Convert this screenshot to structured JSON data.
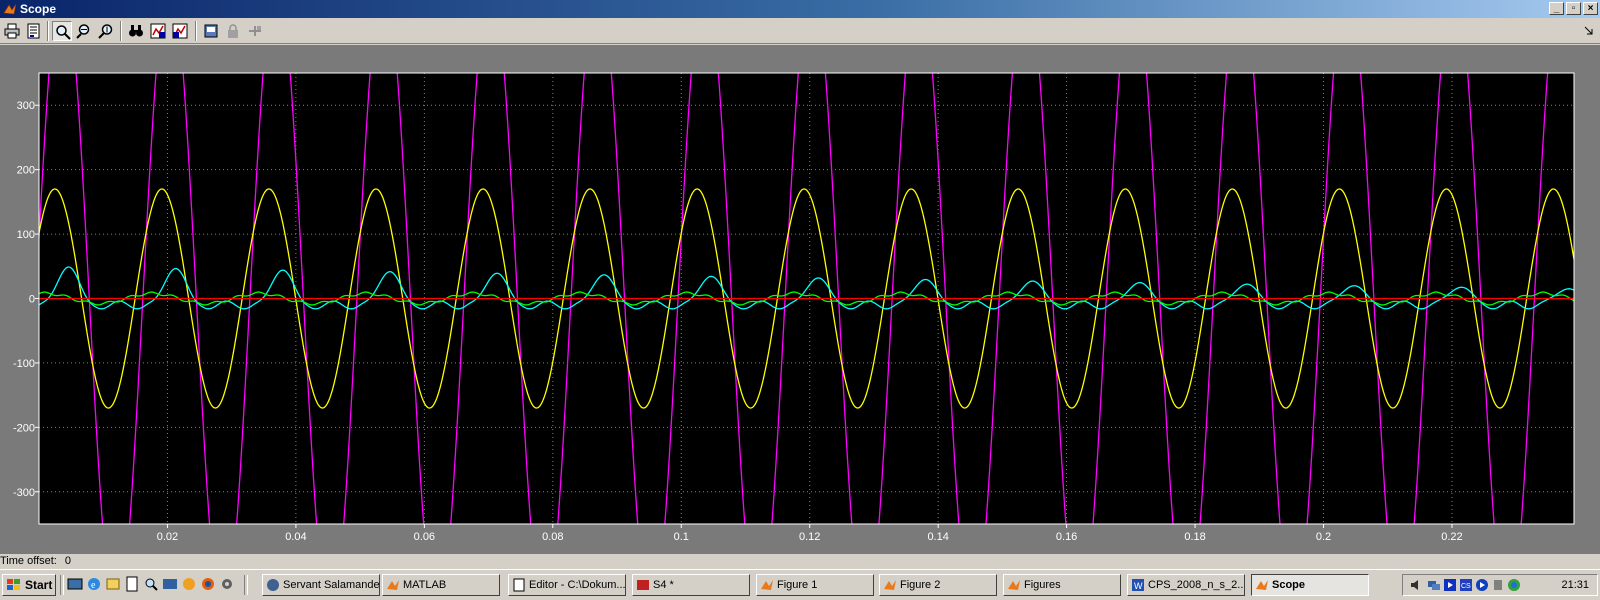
{
  "window": {
    "title": "Scope"
  },
  "toolbar": {
    "buttons": [
      {
        "name": "print-icon"
      },
      {
        "name": "parameters-icon"
      },
      {
        "name": "zoom-icon"
      },
      {
        "name": "zoom-x-icon"
      },
      {
        "name": "zoom-y-icon"
      },
      {
        "name": "autoscale-icon"
      },
      {
        "name": "save-axes-settings-icon"
      },
      {
        "name": "restore-axes-settings-icon"
      },
      {
        "name": "floating-scope-icon"
      },
      {
        "name": "lock-axes-icon"
      },
      {
        "name": "signal-selection-icon"
      }
    ]
  },
  "chart_data": {
    "type": "line",
    "title": "",
    "xlabel": "",
    "ylabel": "",
    "xlim": [
      0.0,
      0.239
    ],
    "ylim": [
      -350,
      350
    ],
    "grid": true,
    "background": "#000000",
    "xticks": [
      0.02,
      0.04,
      0.06,
      0.08,
      0.1,
      0.12,
      0.14,
      0.16,
      0.18,
      0.2,
      0.22
    ],
    "xtick_labels": [
      "0.02",
      "0.04",
      "0.06",
      "0.08",
      "0.1",
      "0.12",
      "0.14",
      "0.16",
      "0.18",
      "0.2",
      "0.22"
    ],
    "yticks": [
      -300,
      -200,
      -100,
      0,
      100,
      200,
      300
    ],
    "ytick_labels": [
      "-300",
      "-200",
      "-100",
      "0",
      "100",
      "200",
      "300"
    ],
    "series": [
      {
        "color": "#ff00ff",
        "description_values": {
          "amplitude": 500,
          "frequency_hz": 60,
          "phase_offset_s": 0.0005
        }
      },
      {
        "color": "#ffff00",
        "description_values": {
          "amplitude": 170,
          "frequency_hz": 60,
          "phase_offset_s": 0.0
        }
      },
      {
        "color": "#00ffff",
        "description_values": {
          "peak_start": 55,
          "peak_end": 20,
          "trough": -10,
          "frequency_hz": 60
        }
      },
      {
        "color": "#00ff00",
        "description_values": {
          "amplitude": 8,
          "frequency_hz": 60
        }
      },
      {
        "color": "#ff0000",
        "description_values": {
          "value": 0
        }
      }
    ]
  },
  "status": {
    "time_offset_label": "Time offset:",
    "time_offset_value": "0"
  },
  "taskbar": {
    "start_label": "Start",
    "tasks": [
      {
        "label": "Servant Salamander",
        "active": false
      },
      {
        "label": "MATLAB",
        "active": false
      },
      {
        "label": "Editor - C:\\Dokum...",
        "active": false
      },
      {
        "label": "S4 *",
        "active": false
      },
      {
        "label": "Figure 1",
        "active": false
      },
      {
        "label": "Figure 2",
        "active": false
      },
      {
        "label": "Figures",
        "active": false
      },
      {
        "label": "CPS_2008_n_s_2...",
        "active": false
      },
      {
        "label": "Scope",
        "active": true
      }
    ],
    "clock": "21:31"
  }
}
